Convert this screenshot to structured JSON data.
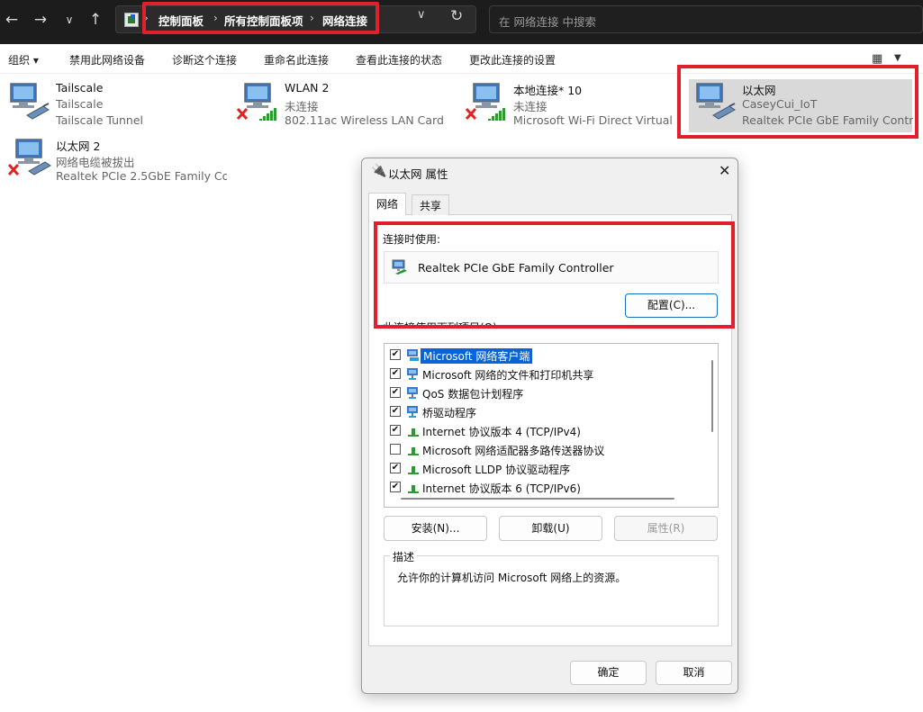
{
  "address_bar": {
    "breadcrumbs": [
      "控制面板",
      "所有控制面板项",
      "网络连接"
    ],
    "search_placeholder": "在 网络连接 中搜索"
  },
  "command_bar": {
    "organize": "组织 ▾",
    "disable": "禁用此网络设备",
    "diagnose": "诊断这个连接",
    "rename": "重命名此连接",
    "view_status": "查看此连接的状态",
    "change_settings": "更改此连接的设置"
  },
  "connections": [
    {
      "name": "Tailscale",
      "status": "Tailscale",
      "device": "Tailscale Tunnel"
    },
    {
      "name": "WLAN 2",
      "status": "未连接",
      "device": "802.11ac Wireless LAN Card"
    },
    {
      "name": "本地连接* 10",
      "status": "未连接",
      "device": "Microsoft Wi-Fi Direct Virtual ..."
    },
    {
      "name": "以太网",
      "status": "CaseyCui_IoT",
      "device": "Realtek PCIe GbE Family Contr..."
    },
    {
      "name": "以太网 2",
      "status": "网络电缆被拔出",
      "device": "Realtek PCIe 2.5GbE Family Co..."
    }
  ],
  "dialog": {
    "title": "以太网 属性",
    "tabs": [
      "网络",
      "共享"
    ],
    "connect_using_label": "连接时使用:",
    "adapter_name": "Realtek PCIe GbE Family Controller",
    "configure_button": "配置(C)...",
    "items_label": "此连接使用下列项目(O):",
    "components": [
      {
        "label": "Microsoft 网络客户端",
        "checked": true
      },
      {
        "label": "Microsoft 网络的文件和打印机共享",
        "checked": true
      },
      {
        "label": "QoS 数据包计划程序",
        "checked": true
      },
      {
        "label": "桥驱动程序",
        "checked": true
      },
      {
        "label": "Internet 协议版本 4 (TCP/IPv4)",
        "checked": true
      },
      {
        "label": "Microsoft 网络适配器多路传送器协议",
        "checked": false
      },
      {
        "label": "Microsoft LLDP 协议驱动程序",
        "checked": true
      },
      {
        "label": "Internet 协议版本 6 (TCP/IPv6)",
        "checked": true
      }
    ],
    "install_button": "安装(N)...",
    "uninstall_button": "卸载(U)",
    "properties_button": "属性(R)",
    "description_title": "描述",
    "description_text": "允许你的计算机访问 Microsoft 网络上的资源。",
    "ok_button": "确定",
    "cancel_button": "取消",
    "check_mark": "✔"
  },
  "colors": {
    "highlight_box": "#e0202a",
    "accent": "#1a6fbf",
    "selection": "#0a64d6"
  }
}
